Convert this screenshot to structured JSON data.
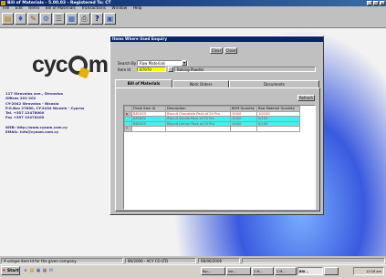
{
  "window": {
    "title": "Bill of Materials - 5.00.03 - Registered To: CT",
    "controls": [
      "_",
      "□",
      "×"
    ]
  },
  "menu": [
    "File",
    "Edit",
    "Items",
    "Bill of Materials",
    "Transactions",
    "Window",
    "Help"
  ],
  "toolbar": {
    "help_label": "?"
  },
  "logo": {
    "text_before": "cyc",
    "text_after": "m"
  },
  "contact": {
    "lines": [
      "117 Strovolos ave., Strovolos",
      "Offices 201-202",
      "CY-2042 Strovolos - Nicosia",
      "P.O.Box 27860, CY-2434 Nicosia - Cyprus",
      "Tel. +357 22478000",
      "Fax +357 22478100"
    ],
    "web": "WEB: http://www.cyaam.com.cy",
    "email": "EMAIL: info@cyaam.com.cy"
  },
  "dialog": {
    "title": "Items Where Used Enquiry",
    "clear_label": "Clear",
    "close_label": "Close",
    "search_by_label": "Search By",
    "search_by_value": "Raw Materials",
    "item_id_label": "Item Id",
    "item_id_value": "B7970",
    "item_description": "Baking Powder",
    "tabs": [
      "Bill of Materials",
      "Work Orders",
      "Documents"
    ],
    "refresh_label": "Refresh",
    "columns": [
      "Finish Item Id",
      "Description",
      "BOM Quantity",
      "Raw Material Quantity"
    ],
    "rows": [
      [
        "B81003",
        "Biscuit Chocolate Pack of 20 Pcs",
        "100/0",
        "10/100"
      ],
      [
        "B81802",
        "Biscuit Vanilla Pack of 20 Pcs",
        "100/0",
        "0/100"
      ],
      [
        "B81003",
        "Biscuit Lemon Pack of 20 Pcs",
        "100/0",
        "0/100"
      ]
    ]
  },
  "status": {
    "message": "A unique item Id for the given company.",
    "company": "86/2006 - ACY CO LTD",
    "date": "08/06/2006"
  },
  "taskbar": {
    "start_label": "Start",
    "tasks": [
      "Rip...",
      "Inb...",
      "2 M...",
      "2 M...",
      "Bill...",
      "",
      ""
    ],
    "clock": "10:28 am"
  }
}
